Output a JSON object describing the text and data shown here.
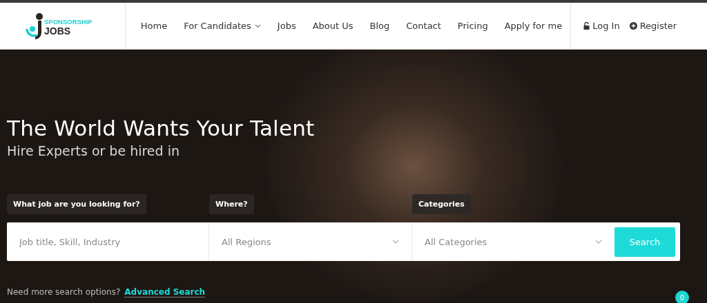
{
  "logo": {
    "top": "SPONSORSHIP",
    "bottom": "JOBS"
  },
  "nav": [
    {
      "label": "Home",
      "dropdown": false
    },
    {
      "label": "For Candidates",
      "dropdown": true
    },
    {
      "label": "Jobs",
      "dropdown": false
    },
    {
      "label": "About Us",
      "dropdown": false
    },
    {
      "label": "Blog",
      "dropdown": false
    },
    {
      "label": "Contact",
      "dropdown": false
    },
    {
      "label": "Pricing",
      "dropdown": false
    },
    {
      "label": "Apply for me",
      "dropdown": false
    }
  ],
  "account": [
    {
      "label": "Log In",
      "kind": "login"
    },
    {
      "label": "Register",
      "kind": "register"
    }
  ],
  "hero": {
    "title": "The World Wants Your Talent",
    "subtitle": "Hire Experts or be hired in"
  },
  "search": {
    "fields": [
      {
        "label": "What job are you looking for?",
        "kind": "text",
        "placeholder": "Job title, Skill, Industry"
      },
      {
        "label": "Where?",
        "kind": "select",
        "value": "All Regions"
      },
      {
        "label": "Categories",
        "kind": "select",
        "value": "All Categories"
      }
    ],
    "button": "Search",
    "more_text": "Need more search options?",
    "more_link": "Advanced Search"
  },
  "badge": "0"
}
